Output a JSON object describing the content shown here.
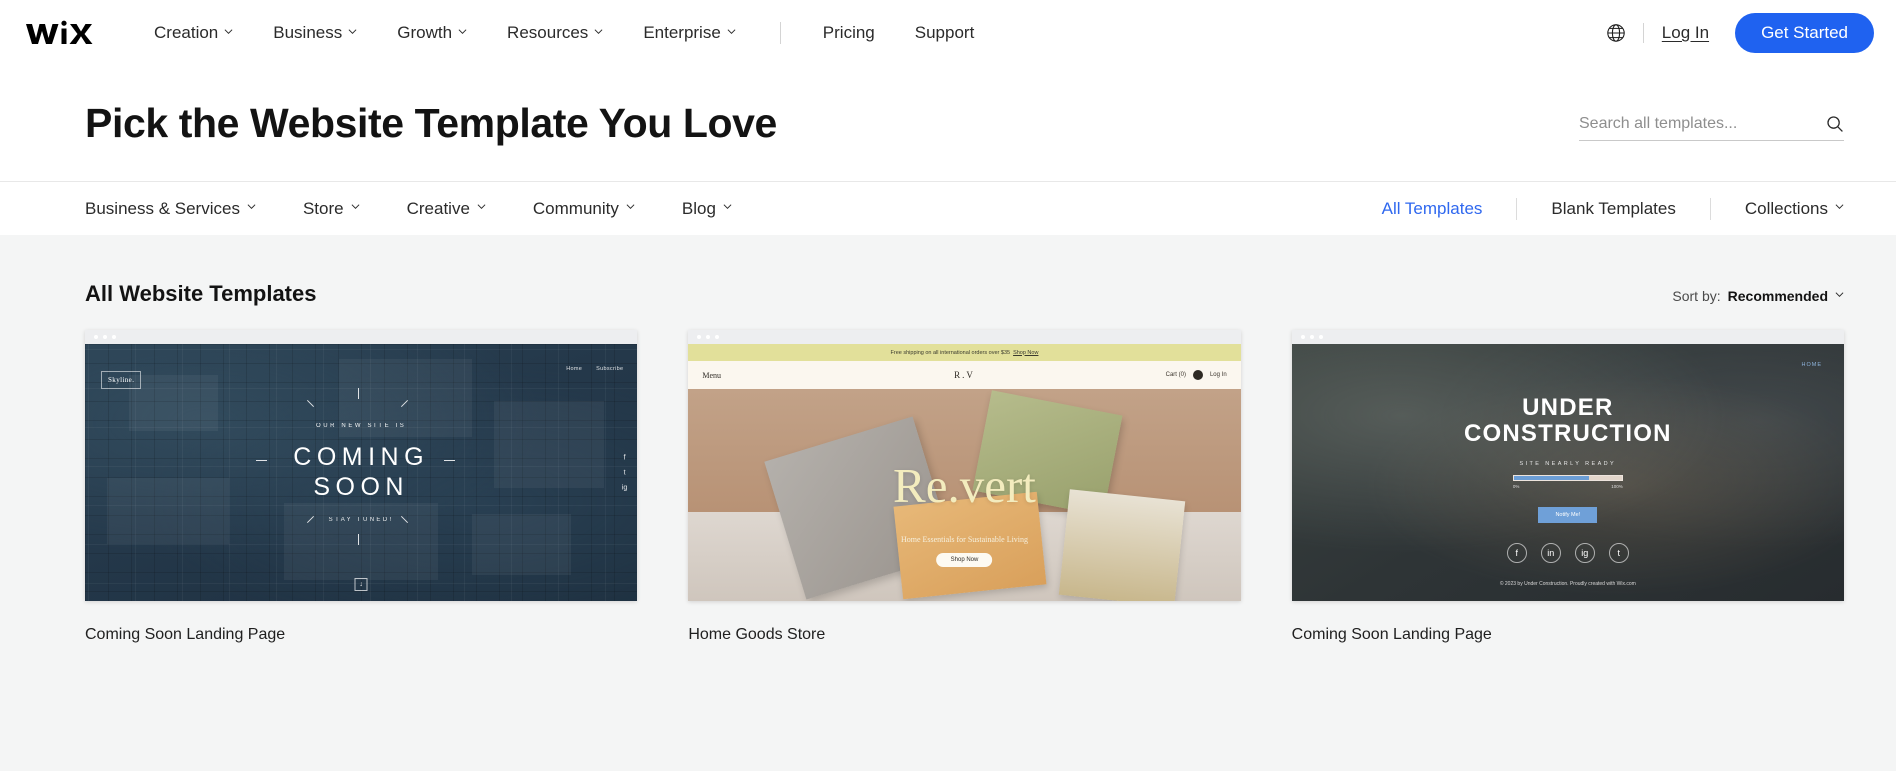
{
  "header": {
    "logo": "wix-logo",
    "nav": [
      {
        "label": "Creation",
        "has_chevron": true
      },
      {
        "label": "Business",
        "has_chevron": true
      },
      {
        "label": "Growth",
        "has_chevron": true
      },
      {
        "label": "Resources",
        "has_chevron": true
      },
      {
        "label": "Enterprise",
        "has_chevron": true
      },
      {
        "label": "Pricing",
        "has_chevron": false
      },
      {
        "label": "Support",
        "has_chevron": false
      }
    ],
    "language_icon": "globe-icon",
    "login_label": "Log In",
    "get_started_label": "Get Started",
    "accent_color": "#1f62f0"
  },
  "hero": {
    "title": "Pick the Website Template You Love",
    "search_placeholder": "Search all templates...",
    "search_value": "",
    "search_icon": "search-icon"
  },
  "categories": {
    "left": [
      {
        "label": "Business & Services",
        "has_chevron": true
      },
      {
        "label": "Store",
        "has_chevron": true
      },
      {
        "label": "Creative",
        "has_chevron": true
      },
      {
        "label": "Community",
        "has_chevron": true
      },
      {
        "label": "Blog",
        "has_chevron": true
      }
    ],
    "right": [
      {
        "label": "All Templates",
        "active": true,
        "has_chevron": false
      },
      {
        "label": "Blank Templates",
        "active": false,
        "has_chevron": false
      },
      {
        "label": "Collections",
        "active": false,
        "has_chevron": true
      }
    ],
    "active_color": "#2f68ef"
  },
  "listing": {
    "section_title": "All Website Templates",
    "sort_label": "Sort by:",
    "sort_value": "Recommended"
  },
  "templates": [
    {
      "title": "Coming Soon Landing Page",
      "preview": {
        "logo": "Skyline.",
        "nav": [
          "Home",
          "Subscribe"
        ],
        "kicker": "OUR NEW SITE IS",
        "headline_line1": "COMING",
        "headline_line2": "SOON",
        "footer_note": "STAY TUNED!",
        "social": [
          "f",
          "t",
          "ig"
        ],
        "scroll_arrow": "↓"
      }
    },
    {
      "title": "Home Goods Store",
      "preview": {
        "announcement": "Free shipping on all international orders over $35",
        "announcement_link": "Shop Now",
        "menu_label": "Menu",
        "brand": "R.V",
        "cart_label": "Cart (0)",
        "login_label": "Log In",
        "headline": "Re.vert",
        "tagline": "Home Essentials for Sustainable Living",
        "cta": "Shop Now"
      }
    },
    {
      "title": "Coming Soon Landing Page",
      "preview": {
        "nav_home": "HOME",
        "headline_line1": "UNDER",
        "headline_line2": "CONSTRUCTION",
        "sub": "SITE NEARLY READY",
        "progress_min": "0%",
        "progress_max": "100%",
        "progress_percent": 70,
        "cta": "Notify Me!",
        "social": [
          "f",
          "in",
          "ig",
          "t"
        ],
        "copyright": "© 2023 by Under Construction. Proudly created with Wix.com"
      }
    }
  ]
}
